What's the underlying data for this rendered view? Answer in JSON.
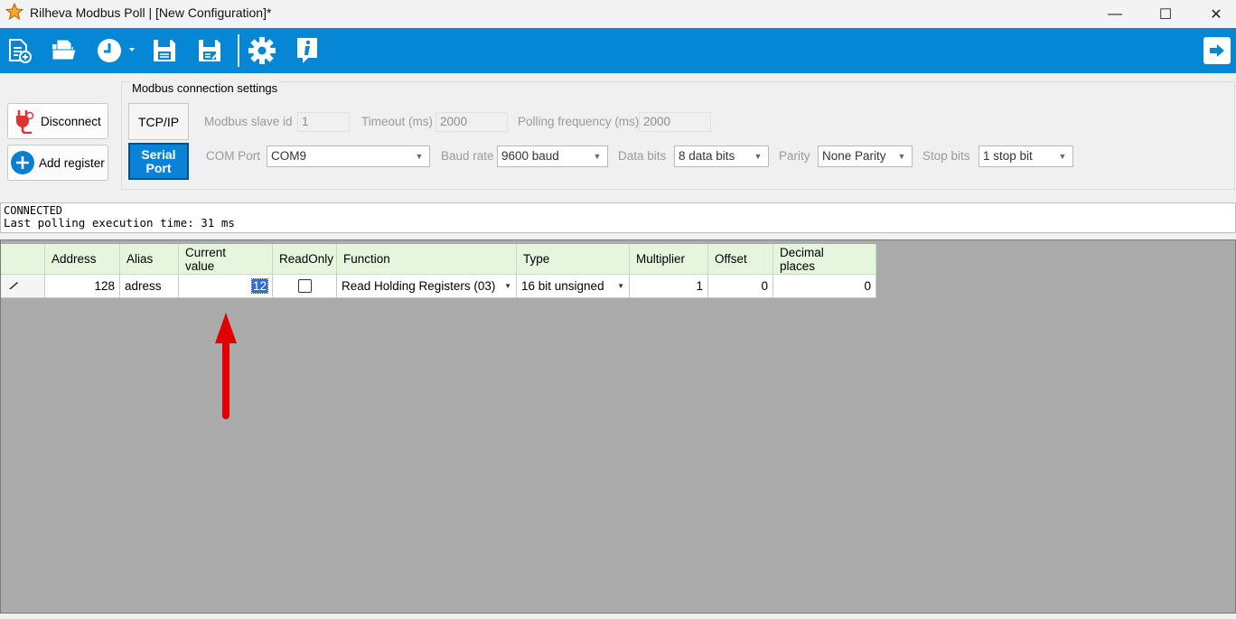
{
  "window": {
    "title": "Rilheva Modbus Poll | [New Configuration]*"
  },
  "window_controls": {
    "minimize": "—",
    "maximize": "☐",
    "close": "✕"
  },
  "toolbar": {
    "buttons": [
      "new-config-icon",
      "open-folder-icon",
      "clock-icon",
      "save-icon",
      "save-as-icon",
      "gear-icon",
      "info-icon",
      "exit-icon"
    ]
  },
  "actions": {
    "disconnect": "Disconnect",
    "add_register": "Add register"
  },
  "connection": {
    "group_title": "Modbus connection settings",
    "tcp_ip": "TCP/IP",
    "serial_port_line1": "Serial",
    "serial_port_line2": "Port",
    "active_mode": "Serial Port",
    "slave_id_label": "Modbus slave id",
    "slave_id": "1",
    "timeout_label": "Timeout (ms)",
    "timeout": "2000",
    "polling_label": "Polling frequency (ms)",
    "polling": "2000",
    "com_port_label": "COM Port",
    "com_port": "COM9",
    "baud_label": "Baud rate",
    "baud": "9600 baud",
    "data_bits_label": "Data bits",
    "data_bits": "8 data bits",
    "parity_label": "Parity",
    "parity": "None Parity",
    "stop_bits_label": "Stop bits",
    "stop_bits": "1 stop bit"
  },
  "status": {
    "line1": "CONNECTED",
    "line2": "Last polling execution time: 31 ms"
  },
  "table": {
    "headers": {
      "address": "Address",
      "alias": "Alias",
      "current_value_1": "Current",
      "current_value_2": "value",
      "readonly": "ReadOnly",
      "function": "Function",
      "type": "Type",
      "multiplier": "Multiplier",
      "offset": "Offset",
      "decimal_1": "Decimal",
      "decimal_2": "places"
    },
    "rows": [
      {
        "address": "128",
        "alias": "adress",
        "current_value": "12",
        "readonly": false,
        "function": "Read Holding Registers (03)",
        "type": "16 bit unsigned",
        "multiplier": "1",
        "offset": "0",
        "decimal_places": "0"
      }
    ]
  },
  "colors": {
    "toolbar": "#0687d6",
    "header": "#e6f6de",
    "grid_background": "#ababab",
    "annotation_arrow": "#e00000"
  }
}
